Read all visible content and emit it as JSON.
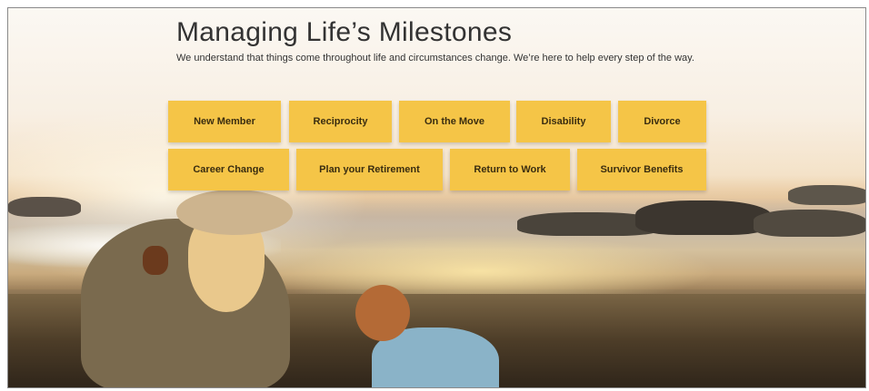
{
  "header": {
    "title": "Managing Life’s Milestones",
    "subtitle": "We understand that things come throughout life and circumstances change. We’re here to help every step of the way."
  },
  "milestone_buttons": {
    "row1": [
      "New Member",
      "Reciprocity",
      "On the Move",
      "Disability",
      "Divorce"
    ],
    "row2": [
      "Career Change",
      "Plan your Retirement",
      "Return to Work",
      "Survivor Benefits"
    ]
  },
  "colors": {
    "button_background": "#f5c547",
    "title_text": "#333333"
  },
  "hero_image": {
    "icon": "beach-photo"
  }
}
